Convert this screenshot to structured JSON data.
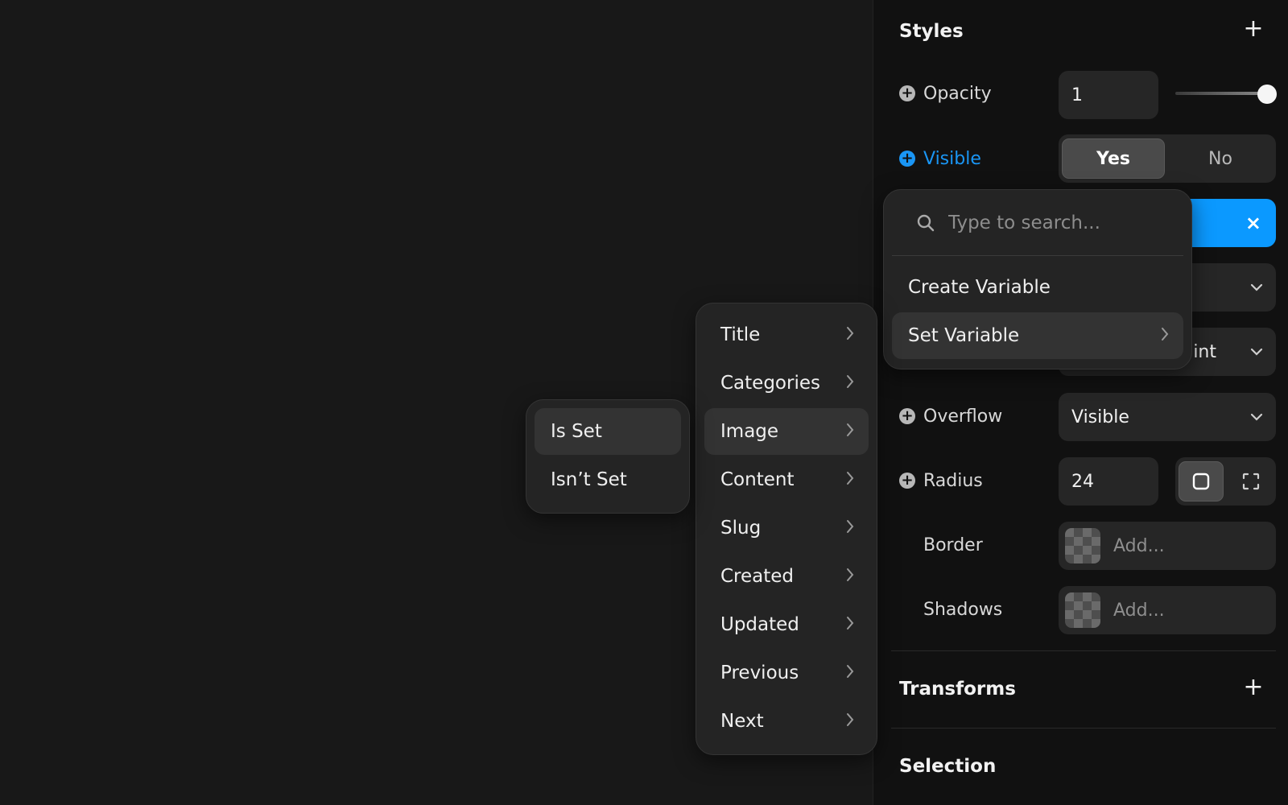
{
  "panel": {
    "styles_title": "Styles",
    "transforms_title": "Transforms",
    "selection_title": "Selection",
    "opacity": {
      "label": "Opacity",
      "value": "1",
      "slider_level": 1.0
    },
    "visible": {
      "label": "Visible",
      "yes": "Yes",
      "no": "No",
      "selected": "Yes"
    },
    "hidden_select_2_suffix": "int",
    "overflow": {
      "label": "Overflow",
      "value": "Visible"
    },
    "radius": {
      "label": "Radius",
      "value": "24"
    },
    "border": {
      "label": "Border",
      "placeholder": "Add..."
    },
    "shadows": {
      "label": "Shadows",
      "placeholder": "Add..."
    },
    "accent_color": "#0b99ff"
  },
  "variable_popup": {
    "search_placeholder": "Type to search...",
    "items": [
      {
        "label": "Create Variable",
        "has_submenu": false
      },
      {
        "label": "Set Variable",
        "has_submenu": true,
        "active": true
      }
    ]
  },
  "fields_menu": {
    "items": [
      {
        "label": "Title"
      },
      {
        "label": "Categories"
      },
      {
        "label": "Image",
        "active": true
      },
      {
        "label": "Content"
      },
      {
        "label": "Slug"
      },
      {
        "label": "Created"
      },
      {
        "label": "Updated"
      },
      {
        "label": "Previous"
      },
      {
        "label": "Next"
      }
    ]
  },
  "condition_menu": {
    "items": [
      {
        "label": "Is Set",
        "active": true
      },
      {
        "label": "Isn’t Set"
      }
    ]
  }
}
